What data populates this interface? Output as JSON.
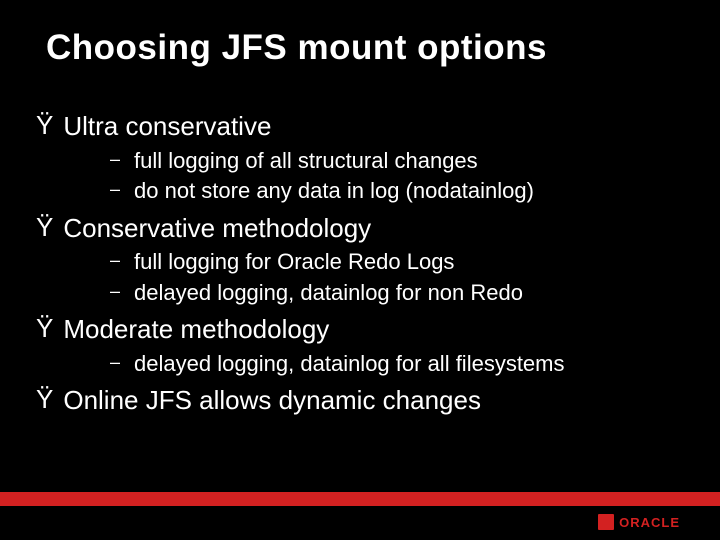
{
  "title": "Choosing JFS mount options",
  "bullet_glyph": "Ÿ",
  "dash_glyph": "–",
  "sections": {
    "s0": {
      "label": "Ultra conservative",
      "items": {
        "i0": "full logging of all structural changes",
        "i1": "do not store any data in log (nodatainlog)"
      }
    },
    "s1": {
      "label": "Conservative methodology",
      "items": {
        "i0": "full logging for Oracle Redo Logs",
        "i1": "delayed logging, datainlog for non Redo"
      }
    },
    "s2": {
      "label": "Moderate methodology",
      "items": {
        "i0": "delayed logging, datainlog for all filesystems"
      }
    },
    "s3": {
      "label": "Online JFS allows dynamic changes",
      "items": {}
    }
  },
  "logo_text": "ORACLE"
}
